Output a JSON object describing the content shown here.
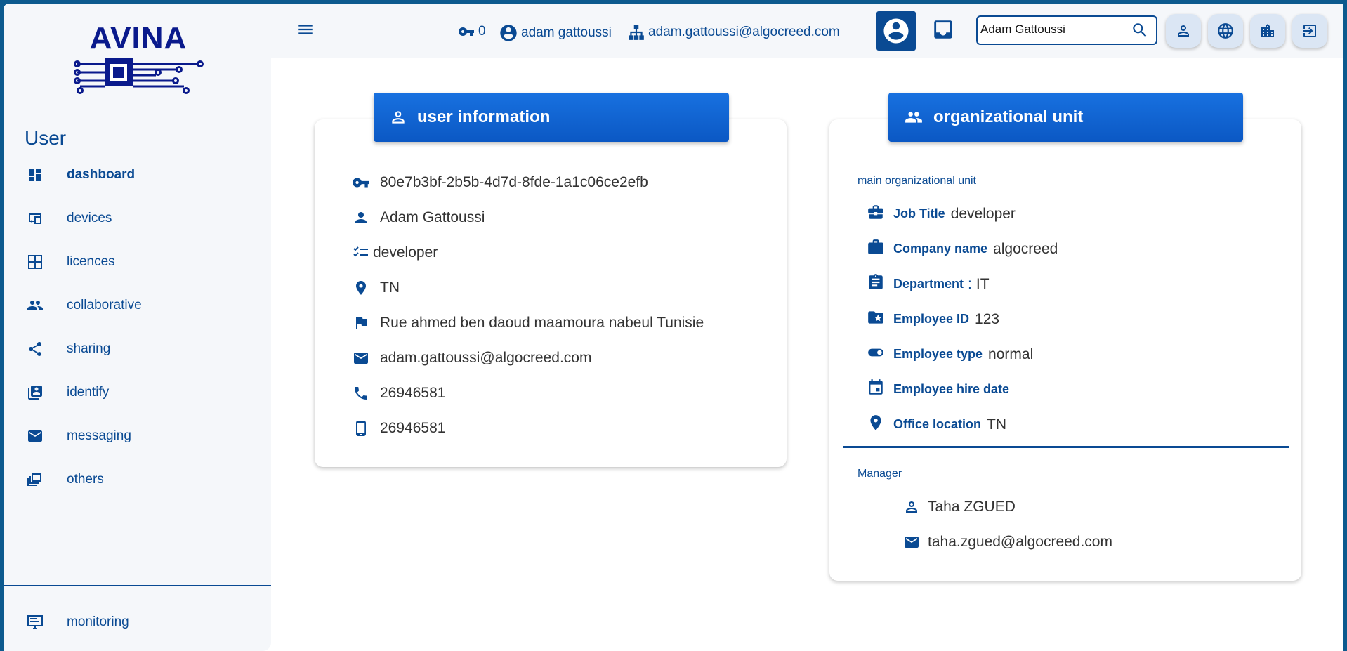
{
  "brand": {
    "logo_text": "AVINA"
  },
  "sidebar": {
    "title": "User",
    "items": [
      {
        "label": "dashboard",
        "icon": "dashboard-icon",
        "active": true
      },
      {
        "label": "devices",
        "icon": "devices-icon"
      },
      {
        "label": "licences",
        "icon": "grid-icon"
      },
      {
        "label": "collaborative",
        "icon": "group-icon"
      },
      {
        "label": "sharing",
        "icon": "share-icon"
      },
      {
        "label": "identify",
        "icon": "badge-icon"
      },
      {
        "label": "messaging",
        "icon": "mail-icon"
      },
      {
        "label": "others",
        "icon": "library-icon"
      }
    ],
    "footer_item": {
      "label": "monitoring",
      "icon": "monitor-icon"
    }
  },
  "topbar": {
    "key_count": "0",
    "username": "adam gattoussi",
    "email": "adam.gattoussi@algocreed.com",
    "search_value": "Adam Gattoussi"
  },
  "user_card": {
    "title": "user information",
    "id": "80e7b3bf-2b5b-4d7d-8fde-1a1c06ce2efb",
    "name": "Adam Gattoussi",
    "role": "developer",
    "country": "TN",
    "address": "Rue ahmed ben daoud maamoura nabeul Tunisie",
    "email": "adam.gattoussi@algocreed.com",
    "phone": "26946581",
    "mobile": "26946581"
  },
  "org_card": {
    "title": "organizational unit",
    "main_label": "main organizational unit",
    "job_title_label": "Job Title",
    "job_title": "developer",
    "company_label": "Company name",
    "company": "algocreed",
    "department_label": "Department",
    "department_sep": ":",
    "department": "IT",
    "employee_id_label": "Employee ID",
    "employee_id": "123",
    "employee_type_label": "Employee type",
    "employee_type": "normal",
    "hire_date_label": "Employee hire date",
    "office_label": "Office location",
    "office": "TN",
    "manager_label": "Manager",
    "manager_name": "Taha ZGUED",
    "manager_email": "taha.zgued@algocreed.com"
  },
  "colors": {
    "primary": "#0a4a93",
    "accent": "#1871e0",
    "sidebar_bg": "#f5f7fa",
    "frame": "#0d5a8e"
  }
}
